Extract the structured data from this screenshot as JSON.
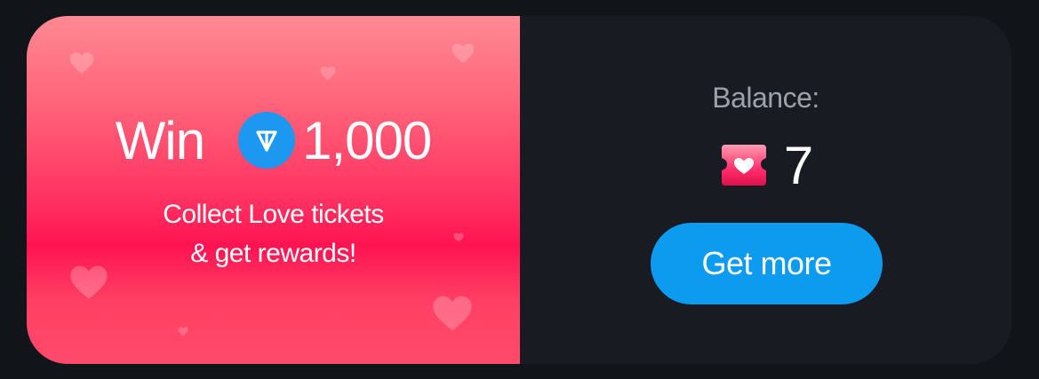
{
  "promo": {
    "win_label": "Win",
    "currency_icon": "ton-coin-icon",
    "amount": "1,000",
    "subtitle_line1": "Collect Love tickets",
    "subtitle_line2": "& get rewards!",
    "gradient_top": "#ff8a93",
    "gradient_mid": "#ff1352",
    "decoration_icon": "heart-icon"
  },
  "balance": {
    "label": "Balance:",
    "ticket_icon": "love-ticket-icon",
    "value": "7"
  },
  "actions": {
    "get_more_label": "Get more"
  },
  "colors": {
    "background": "#111419",
    "panel": "#181b22",
    "accent": "#0d9bf0",
    "ton_blue": "#1d98f0",
    "muted_text": "#9da1a9"
  }
}
